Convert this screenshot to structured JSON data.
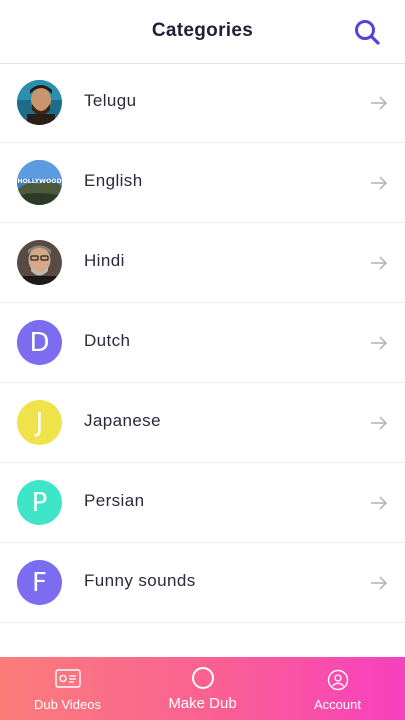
{
  "header": {
    "title": "Categories",
    "search_icon": "search-icon"
  },
  "categories": [
    {
      "label": "Telugu",
      "avatar": "photo",
      "color": "#3a2a20"
    },
    {
      "label": "English",
      "avatar": "photo",
      "color": "#3f7fc6"
    },
    {
      "label": "Hindi",
      "avatar": "photo",
      "color": "#2e2620"
    },
    {
      "label": "Dutch",
      "avatar": "letter",
      "letter": "D",
      "color": "#7b6cf0"
    },
    {
      "label": "Japanese",
      "avatar": "letter",
      "letter": "J",
      "color": "#efe24a"
    },
    {
      "label": "Persian",
      "avatar": "letter",
      "letter": "P",
      "color": "#3ee6c7"
    },
    {
      "label": "Funny sounds",
      "avatar": "letter",
      "letter": "F",
      "color": "#7b6cf0"
    }
  ],
  "english_avatar_sign": "HOLLYWOOD",
  "bottom_nav": [
    {
      "label": "Dub Videos",
      "icon": "video-card-icon"
    },
    {
      "label": "Make Dub",
      "icon": "record-circle-icon"
    },
    {
      "label": "Account",
      "icon": "account-icon"
    }
  ],
  "colors": {
    "accent": "#5b3fd6",
    "nav_gradient_start": "#fb7d7a",
    "nav_gradient_end": "#f83fc0",
    "arrow": "#b5b5b5"
  }
}
